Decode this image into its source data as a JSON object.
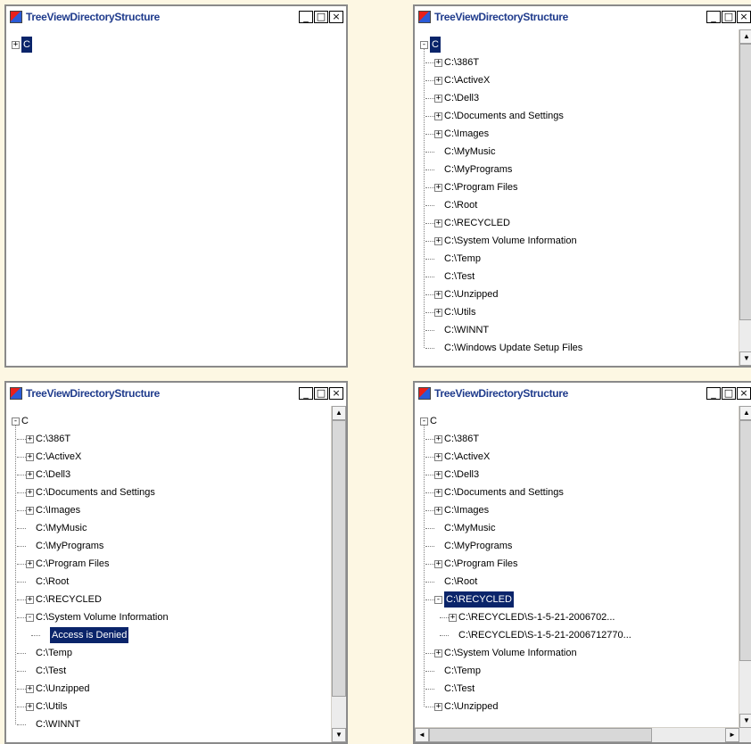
{
  "windows": [
    {
      "id": "w1",
      "title": "TreeViewDirectoryStructure",
      "min": "_",
      "max": "□",
      "close": "×",
      "nodes": [
        {
          "label": "C",
          "exp": "+",
          "sel": true
        }
      ]
    },
    {
      "id": "w2",
      "title": "TreeViewDirectoryStructure",
      "min": "_",
      "max": "□",
      "close": "×",
      "scroll": {
        "up": "▲",
        "down": "▼"
      },
      "nodes": [
        {
          "label": "C",
          "exp": "-",
          "sel": true
        },
        {
          "label": "C:\\386T",
          "exp": "+",
          "indent": 1
        },
        {
          "label": "C:\\ActiveX",
          "exp": "+",
          "indent": 1
        },
        {
          "label": "C:\\Dell3",
          "exp": "+",
          "indent": 1
        },
        {
          "label": "C:\\Documents and Settings",
          "exp": "+",
          "indent": 1
        },
        {
          "label": "C:\\Images",
          "exp": "+",
          "indent": 1
        },
        {
          "label": "C:\\MyMusic",
          "exp": "",
          "indent": 1
        },
        {
          "label": "C:\\MyPrograms",
          "exp": "",
          "indent": 1
        },
        {
          "label": "C:\\Program Files",
          "exp": "+",
          "indent": 1
        },
        {
          "label": "C:\\Root",
          "exp": "",
          "indent": 1
        },
        {
          "label": "C:\\RECYCLED",
          "exp": "+",
          "indent": 1
        },
        {
          "label": "C:\\System Volume Information",
          "exp": "+",
          "indent": 1
        },
        {
          "label": "C:\\Temp",
          "exp": "",
          "indent": 1
        },
        {
          "label": "C:\\Test",
          "exp": "",
          "indent": 1
        },
        {
          "label": "C:\\Unzipped",
          "exp": "+",
          "indent": 1
        },
        {
          "label": "C:\\Utils",
          "exp": "+",
          "indent": 1
        },
        {
          "label": "C:\\WINNT",
          "exp": "",
          "indent": 1
        },
        {
          "label": "C:\\Windows Update Setup Files",
          "exp": "",
          "indent": 1
        }
      ]
    },
    {
      "id": "w3",
      "title": "TreeViewDirectoryStructure",
      "min": "_",
      "max": "□",
      "close": "×",
      "scroll": {
        "up": "▲",
        "down": "▼"
      },
      "nodes": [
        {
          "label": "C",
          "exp": "-"
        },
        {
          "label": "C:\\386T",
          "exp": "+",
          "indent": 1
        },
        {
          "label": "C:\\ActiveX",
          "exp": "+",
          "indent": 1
        },
        {
          "label": "C:\\Dell3",
          "exp": "+",
          "indent": 1
        },
        {
          "label": "C:\\Documents and Settings",
          "exp": "+",
          "indent": 1
        },
        {
          "label": "C:\\Images",
          "exp": "+",
          "indent": 1
        },
        {
          "label": "C:\\MyMusic",
          "exp": "",
          "indent": 1
        },
        {
          "label": "C:\\MyPrograms",
          "exp": "",
          "indent": 1
        },
        {
          "label": "C:\\Program Files",
          "exp": "+",
          "indent": 1
        },
        {
          "label": "C:\\Root",
          "exp": "",
          "indent": 1
        },
        {
          "label": "C:\\RECYCLED",
          "exp": "+",
          "indent": 1
        },
        {
          "label": "C:\\System Volume Information",
          "exp": "-",
          "indent": 1
        },
        {
          "label": "Access is Denied",
          "exp": "",
          "indent": 2,
          "sel": true
        },
        {
          "label": "C:\\Temp",
          "exp": "",
          "indent": 1
        },
        {
          "label": "C:\\Test",
          "exp": "",
          "indent": 1
        },
        {
          "label": "C:\\Unzipped",
          "exp": "+",
          "indent": 1
        },
        {
          "label": "C:\\Utils",
          "exp": "+",
          "indent": 1
        },
        {
          "label": "C:\\WINNT",
          "exp": "",
          "indent": 1
        }
      ]
    },
    {
      "id": "w4",
      "title": "TreeViewDirectoryStructure",
      "min": "_",
      "max": "□",
      "close": "×",
      "scroll": {
        "up": "▲",
        "down": "▼",
        "left": "◄",
        "right": "►"
      },
      "nodes": [
        {
          "label": "C",
          "exp": "-"
        },
        {
          "label": "C:\\386T",
          "exp": "+",
          "indent": 1
        },
        {
          "label": "C:\\ActiveX",
          "exp": "+",
          "indent": 1
        },
        {
          "label": "C:\\Dell3",
          "exp": "+",
          "indent": 1
        },
        {
          "label": "C:\\Documents and Settings",
          "exp": "+",
          "indent": 1
        },
        {
          "label": "C:\\Images",
          "exp": "+",
          "indent": 1
        },
        {
          "label": "C:\\MyMusic",
          "exp": "",
          "indent": 1
        },
        {
          "label": "C:\\MyPrograms",
          "exp": "",
          "indent": 1
        },
        {
          "label": "C:\\Program Files",
          "exp": "+",
          "indent": 1
        },
        {
          "label": "C:\\Root",
          "exp": "",
          "indent": 1
        },
        {
          "label": "C:\\RECYCLED",
          "exp": "-",
          "indent": 1,
          "sel": true
        },
        {
          "label": "C:\\RECYCLED\\S-1-5-21-2006702...",
          "exp": "+",
          "indent": 2
        },
        {
          "label": "C:\\RECYCLED\\S-1-5-21-2006712770...",
          "exp": "",
          "indent": 2
        },
        {
          "label": "C:\\System Volume Information",
          "exp": "+",
          "indent": 1
        },
        {
          "label": "C:\\Temp",
          "exp": "",
          "indent": 1
        },
        {
          "label": "C:\\Test",
          "exp": "",
          "indent": 1
        },
        {
          "label": "C:\\Unzipped",
          "exp": "+",
          "indent": 1
        }
      ]
    }
  ]
}
